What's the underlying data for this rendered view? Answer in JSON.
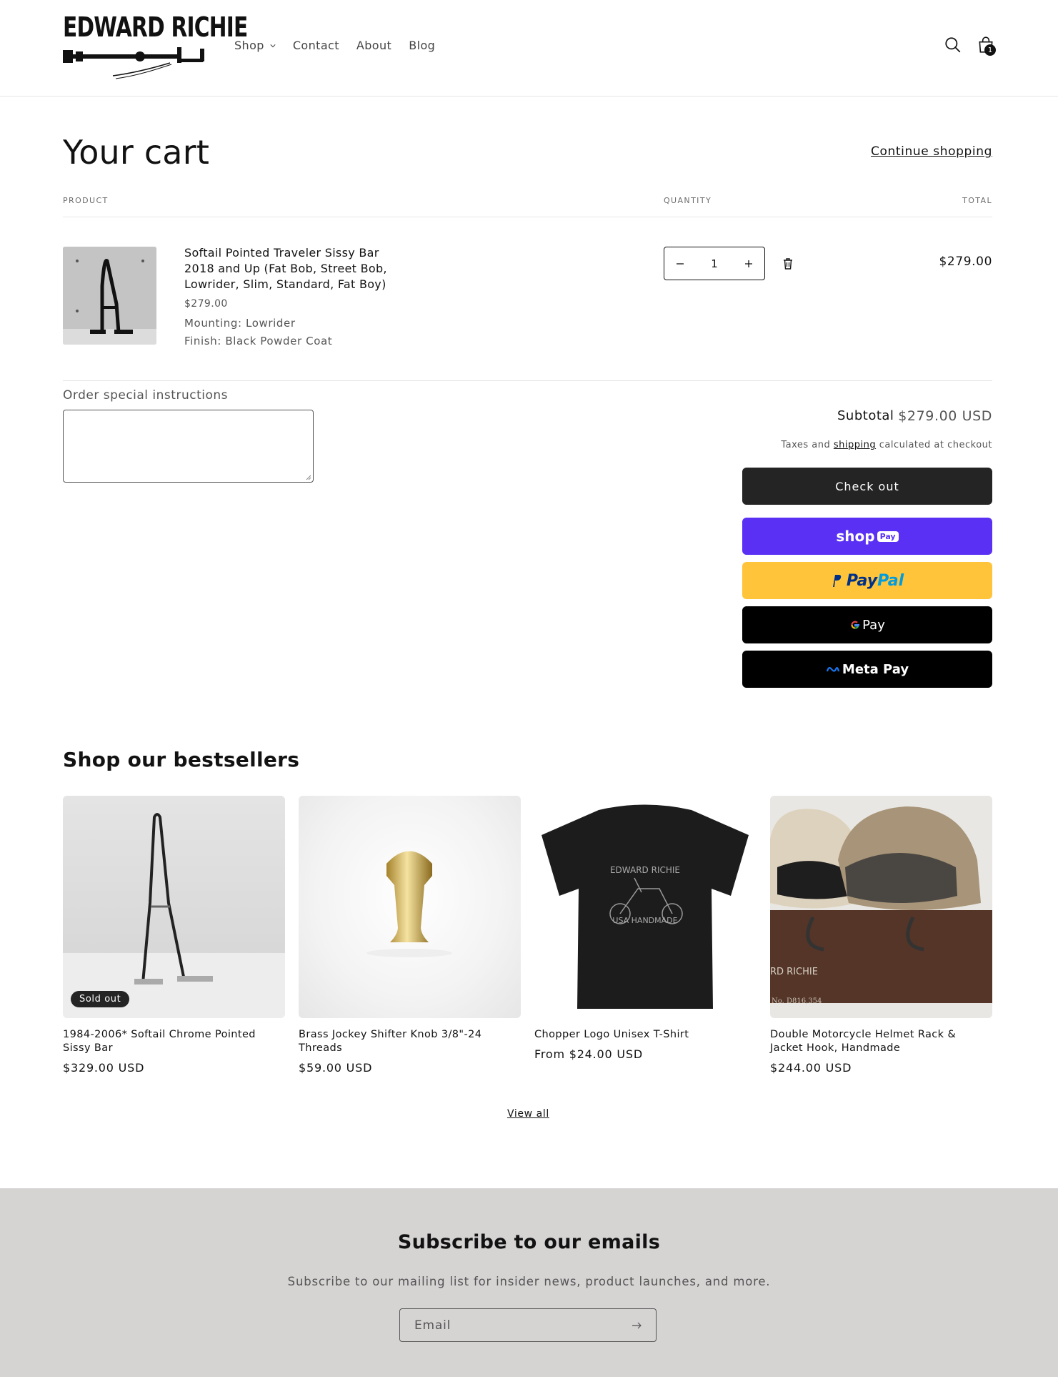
{
  "header": {
    "logo_text": "EDWARD RICHIE",
    "nav": [
      {
        "label": "Shop"
      },
      {
        "label": "Contact"
      },
      {
        "label": "About"
      },
      {
        "label": "Blog"
      }
    ],
    "cart_count": "1"
  },
  "cart": {
    "title": "Your cart",
    "continue_label": "Continue shopping",
    "columns": {
      "product": "PRODUCT",
      "quantity": "QUANTITY",
      "total": "TOTAL"
    },
    "item": {
      "title": "Softail Pointed Traveler Sissy Bar 2018 and Up (Fat Bob, Street Bob, Lowrider, Slim, Standard, Fat Boy)",
      "price": "$279.00",
      "mounting": "Mounting: Lowrider",
      "finish": "Finish: Black Powder Coat",
      "quantity": "1",
      "total": "$279.00"
    },
    "instructions_label": "Order special instructions",
    "subtotal_label": "Subtotal",
    "subtotal_value": "$279.00 USD",
    "tax_prefix": "Taxes and ",
    "tax_link": "shipping",
    "tax_suffix": " calculated at checkout",
    "checkout_label": "Check out",
    "payments": {
      "shop": "shop",
      "shop_pill": "Pay",
      "paypal_1": "Pay",
      "paypal_2": "Pal",
      "gpay": "Pay",
      "meta": "Meta Pay"
    }
  },
  "bestsellers": {
    "title": "Shop our bestsellers",
    "products": [
      {
        "title": "1984-2006* Softail Chrome Pointed Sissy Bar",
        "price": "$329.00 USD",
        "badge": "Sold out"
      },
      {
        "title": "Brass Jockey Shifter Knob 3/8\"-24 Threads",
        "price": "$59.00 USD"
      },
      {
        "title": "Chopper Logo Unisex T-Shirt",
        "price": "From $24.00 USD"
      },
      {
        "title": "Double Motorcycle Helmet Rack & Jacket Hook, Handmade",
        "price": "$244.00 USD"
      }
    ],
    "view_all": "View all",
    "tshirt_text_1": "EDWARD RICHIE",
    "tshirt_text_2": "USA HANDMADE",
    "helmet_watermark": "RD RICHIE",
    "helmet_patent": "No. D816,354"
  },
  "newsletter": {
    "title": "Subscribe to our emails",
    "subtitle": "Subscribe to our mailing list for insider news, product launches, and more.",
    "email_placeholder": "Email"
  }
}
